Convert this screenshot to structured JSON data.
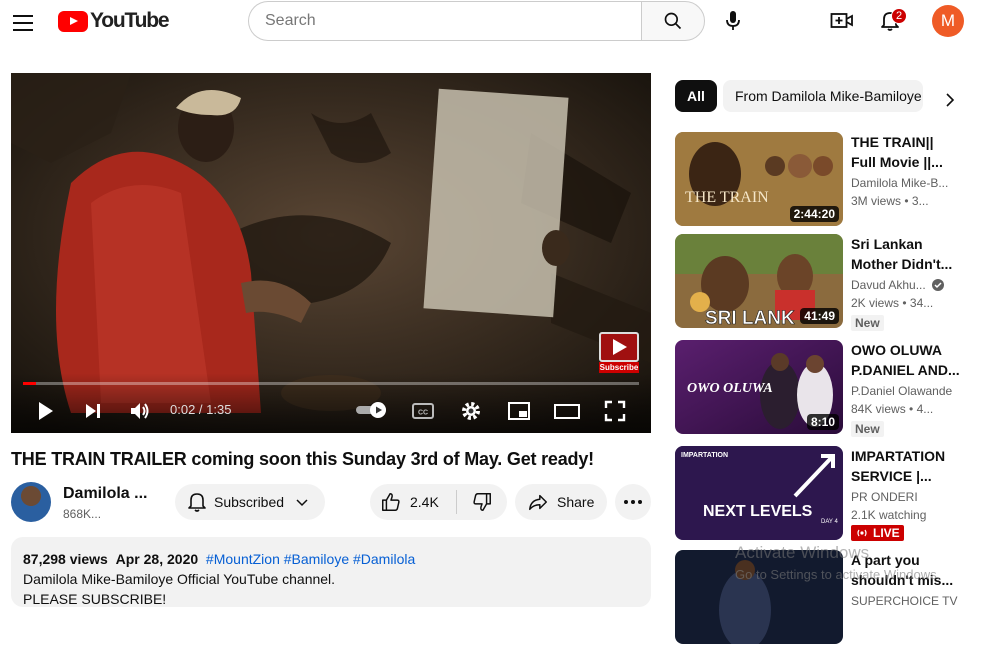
{
  "header": {
    "logo_text": "YouTube",
    "search_placeholder": "Search",
    "notification_count": "2",
    "avatar_letter": "M"
  },
  "player": {
    "current_time": "0:02 / 1:35",
    "progress": 0.021,
    "subscribe_watermark": "Subscribe"
  },
  "video": {
    "title": "THE TRAIN TRAILER coming soon this Sunday 3rd of May. Get ready!",
    "channel_name": "Damilola ...",
    "channel_subs": "868K...",
    "subscribed_label": "Subscribed",
    "likes": "2.4K",
    "share_label": "Share"
  },
  "description": {
    "views": "87,298 views",
    "date": "Apr 28, 2020",
    "tags": "#MountZion #Bamiloye #Damilola",
    "line1": "Damilola Mike-Bamiloye Official YouTube channel.",
    "line2": "PLEASE SUBSCRIBE!"
  },
  "chips": {
    "all": "All",
    "from": "From Damilola Mike-Bamiloye"
  },
  "recommendations": [
    {
      "title": "THE TRAIN|| Full Movie ||...",
      "channel": "Damilola Mike-B...",
      "views": "3M views",
      "age": "3...",
      "duration": "2:44:20",
      "thumb_text": "THE TRAIN"
    },
    {
      "title": "Sri Lankan Mother Didn't...",
      "channel": "Davud Akhu...",
      "views": "2K views",
      "age": "34...",
      "duration": "41:49",
      "badge": "New",
      "thumb_text": "SRI LANK"
    },
    {
      "title": "OWO OLUWA P.DANIEL AND...",
      "channel": "P.Daniel Olawande",
      "views": "84K views",
      "age": "4...",
      "duration": "8:10",
      "badge": "New",
      "thumb_text": "OWO OLUWA"
    },
    {
      "title": "IMPARTATION SERVICE |...",
      "channel": "PR ONDERI",
      "views": "2.1K watching",
      "live_label": "LIVE",
      "thumb_text": "NEXT LEVELS",
      "thumb_caption": "IMPARTATION",
      "thumb_day": "DAY 4"
    },
    {
      "title": "A part you shouldn't mis...",
      "channel": "SUPERCHOICE TV"
    }
  ],
  "watermark": {
    "line1": "Activate Windows",
    "line2": "Go to Settings to activate Windows."
  }
}
